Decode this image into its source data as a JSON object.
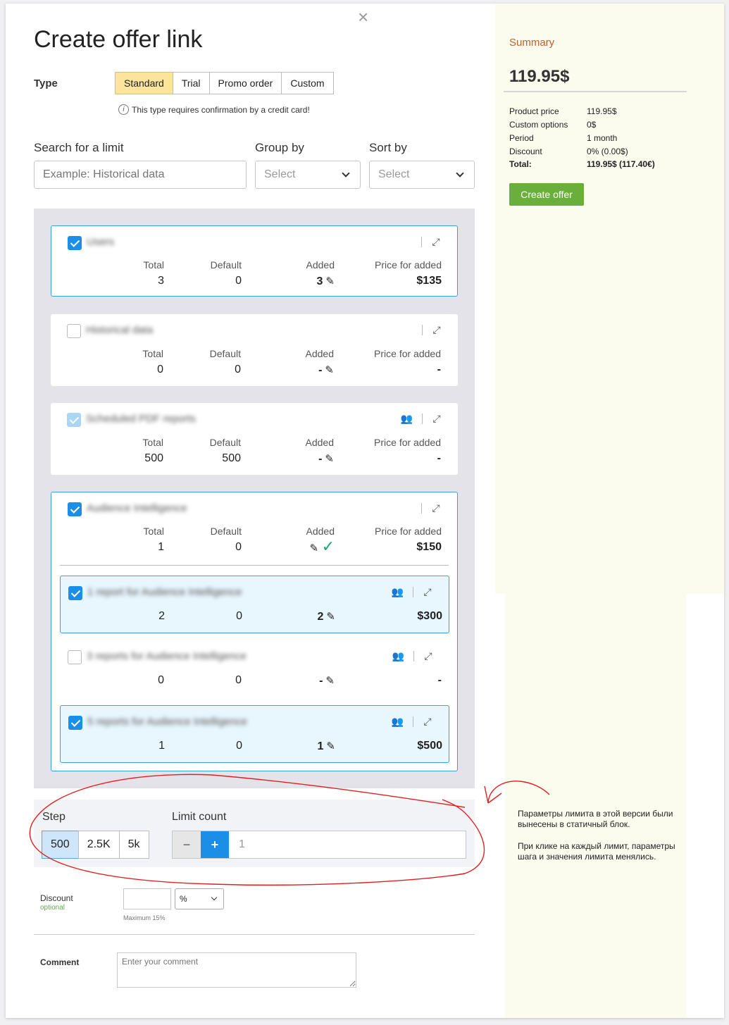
{
  "modal": {
    "title": "Create offer link",
    "close_glyph": "×",
    "type_label": "Type",
    "type_options": [
      "Standard",
      "Trial",
      "Promo order",
      "Custom"
    ],
    "type_note": "This type requires confirmation by a credit card!",
    "info_glyph": "i",
    "search_label": "Search for a limit",
    "search_placeholder": "Example: Historical data",
    "group_label": "Group by",
    "group_value": "Select",
    "sort_label": "Sort by",
    "sort_value": "Select"
  },
  "columns": {
    "total": "Total",
    "default": "Default",
    "added": "Added",
    "price": "Price for added"
  },
  "limits": [
    {
      "name": "Users",
      "total": "3",
      "default": "0",
      "added": "3",
      "price": "$135"
    },
    {
      "name": "Historical data",
      "total": "0",
      "default": "0",
      "added": "-",
      "price": "-"
    },
    {
      "name": "Scheduled PDF reports",
      "total": "500",
      "default": "500",
      "added": "-",
      "price": "-"
    },
    {
      "name": "Audience Intelligence",
      "total": "1",
      "default": "0",
      "added": "",
      "price": "$150"
    }
  ],
  "sub_limits": [
    {
      "name": "1 report for Audience Intelligence",
      "total": "2",
      "default": "0",
      "added": "2",
      "price": "$300"
    },
    {
      "name": "3 reports for Audience Intelligence",
      "total": "0",
      "default": "0",
      "added": "-",
      "price": "-"
    },
    {
      "name": "5 reports for Audience Intelligence",
      "total": "1",
      "default": "0",
      "added": "1",
      "price": "$500"
    }
  ],
  "step": {
    "label": "Step",
    "options": [
      "500",
      "2.5K",
      "5k"
    ],
    "limit_label": "Limit count",
    "minus": "−",
    "plus": "+",
    "value": "1"
  },
  "discount": {
    "label": "Discount",
    "optional": "optional",
    "unit": "%",
    "max_note": "Maximum 15%"
  },
  "comment": {
    "label": "Comment",
    "placeholder": "Enter your comment"
  },
  "summary": {
    "title": "Summary",
    "total": "119.95$",
    "rows": [
      {
        "k": "Product price",
        "v": "119.95$"
      },
      {
        "k": "Custom options",
        "v": "0$"
      },
      {
        "k": "Period",
        "v": "1 month"
      },
      {
        "k": "Discount",
        "v": "0% (0.00$)"
      },
      {
        "k": "Total:",
        "v": "119.95$ (117.40€)"
      }
    ],
    "button": "Create offer"
  },
  "annotation": {
    "line1": "Параметры лимита в этой версии были вынесены в статичный блок.",
    "line2": "При клике на каждый лимит, параметры шага и значения лимита менялись."
  },
  "colors": {
    "accent": "#1b8ee8",
    "type_active": "#fbe49b",
    "summary_bg": "#fbfbee",
    "create_btn": "#6aaf3c",
    "annotation": "#e02020"
  }
}
